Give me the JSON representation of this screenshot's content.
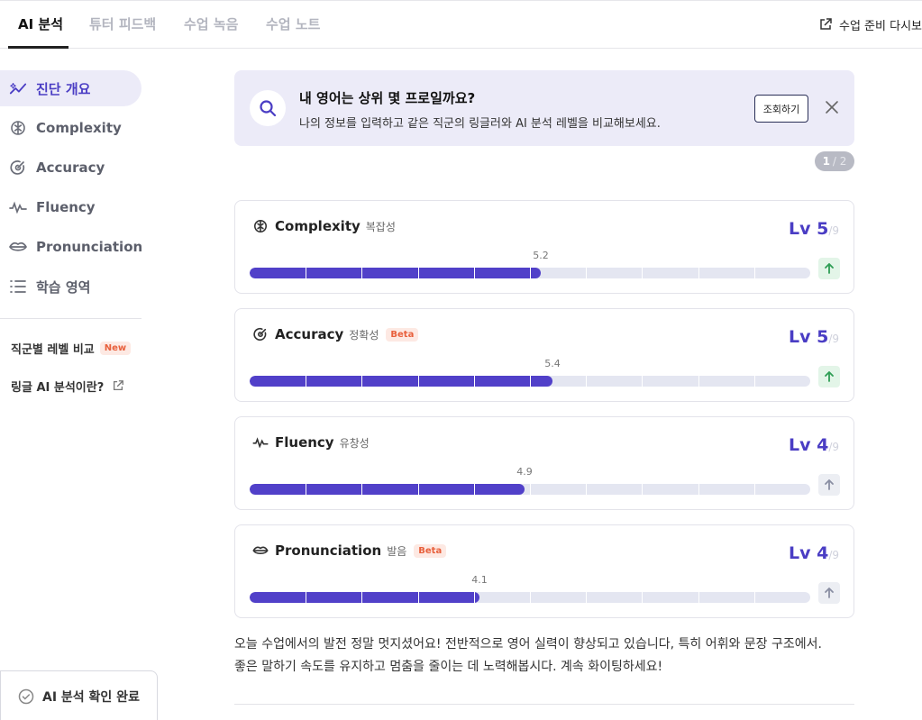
{
  "tabs": [
    {
      "label": "AI 분석",
      "active": true
    },
    {
      "label": "튜터 피드백",
      "active": false
    },
    {
      "label": "수업 녹음",
      "active": false
    },
    {
      "label": "수업 노트",
      "active": false
    }
  ],
  "header_action": {
    "label": "수업 준비 다시보",
    "icon": "external-link-icon"
  },
  "sidebar": {
    "items": [
      {
        "label": "진단 개요",
        "icon": "trend-icon",
        "active": true
      },
      {
        "label": "Complexity",
        "icon": "brain-icon"
      },
      {
        "label": "Accuracy",
        "icon": "target-icon"
      },
      {
        "label": "Fluency",
        "icon": "wave-icon"
      },
      {
        "label": "Pronunciation",
        "icon": "lips-icon"
      },
      {
        "label": "학습 영역",
        "icon": "list-icon"
      }
    ],
    "links": [
      {
        "label": "직군별 레벨 비교",
        "badge": "New"
      },
      {
        "label": "링글 AI 분석이란?",
        "icon": "external-link-icon"
      }
    ]
  },
  "banner": {
    "title": "내 영어는 상위 몇 프로일까요?",
    "subtitle": "나의 정보를 입력하고 같은 직군의 링글러와 AI 분석 레벨을 비교해보세요.",
    "button": "조회하기",
    "page_current": "1",
    "page_total": "/ 2"
  },
  "metrics": [
    {
      "name": "Complexity",
      "ko": "복잡성",
      "beta": "",
      "lv": "Lv 5",
      "max": "/9",
      "value": 5.2,
      "value_label": "5.2",
      "trend": "up"
    },
    {
      "name": "Accuracy",
      "ko": "정확성",
      "beta": "Beta",
      "lv": "Lv 5",
      "max": "/9",
      "value": 5.4,
      "value_label": "5.4",
      "trend": "up"
    },
    {
      "name": "Fluency",
      "ko": "유창성",
      "beta": "",
      "lv": "Lv 4",
      "max": "/9",
      "value": 4.9,
      "value_label": "4.9",
      "trend": "flat"
    },
    {
      "name": "Pronunciation",
      "ko": "발음",
      "beta": "Beta",
      "lv": "Lv 4",
      "max": "/9",
      "value": 4.1,
      "value_label": "4.1",
      "trend": "flat"
    }
  ],
  "scale_max": 10,
  "summary": {
    "line1": "오늘 수업에서의 발전 정말 멋지셨어요! 전반적으로 영어 실력이 향상되고 있습니다, 특히 어휘와 문장 구조에서.",
    "line2": "좋은 말하기 속도를 유지하고 멈춤을 줄이는 데 노력해봅시다. 계속 화이팅하세요!"
  },
  "confirm_button": "AI 분석 확인 완료",
  "colors": {
    "accent": "#4a3dc4",
    "bar": "#5140c9",
    "track": "#e4e6f1",
    "badge": "#e8603c",
    "up": "#2f9e55"
  }
}
